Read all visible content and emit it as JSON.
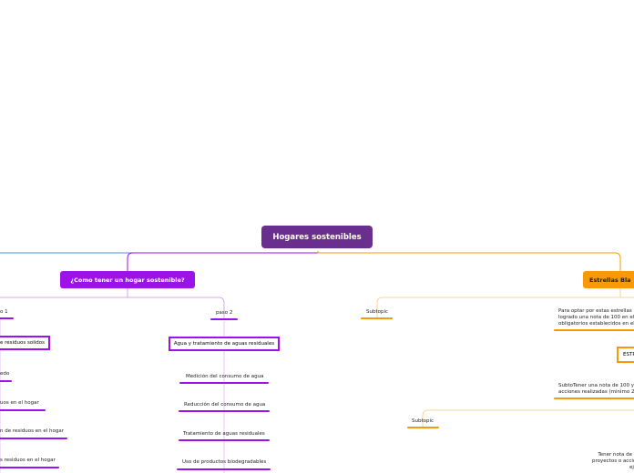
{
  "map": {
    "central_topic": "Hogares sostenibles",
    "branch_left": {
      "title": "¿Como tener un hogar sostenible?",
      "paso1_label": "o 1",
      "paso1_boxed": "e residuos solidos",
      "paso1_items": [
        "edo",
        "uos en el hogar",
        "n de residuos en el hogar",
        "s residuos en el hogar"
      ],
      "paso2_label": "paso 2",
      "paso2_boxed": "Agua y tratamiento de aguas residuales",
      "paso2_items": [
        "Medición del consumo de agua",
        "Reducción del consumo de agua",
        "Tratamiento de aguas residuales",
        "Uso de productos biodegradables"
      ]
    },
    "branch_right": {
      "title": "Estrellas Bla",
      "subtopic_1": "Subtopic",
      "subtopic_2": "Subtopic",
      "para_optar": "Para optar por estas estrellas\nlogrado una nota de 100 en el\nobligatorios establecidos en el",
      "boxed": "ESTR",
      "subto_tener": "SubtoTener una nota de 100 y\nacciones realizadas (minimo 2",
      "tener_nota": "Tener nota de 100,\nproyectos o acciones\nejecut"
    }
  },
  "colors": {
    "center": "#6a2f8e",
    "purple": "#9b13e8",
    "purple_light": "#d48cf5",
    "orange": "#f79a05",
    "orange_light": "#f8c878",
    "blue": "#4f8fd8"
  }
}
